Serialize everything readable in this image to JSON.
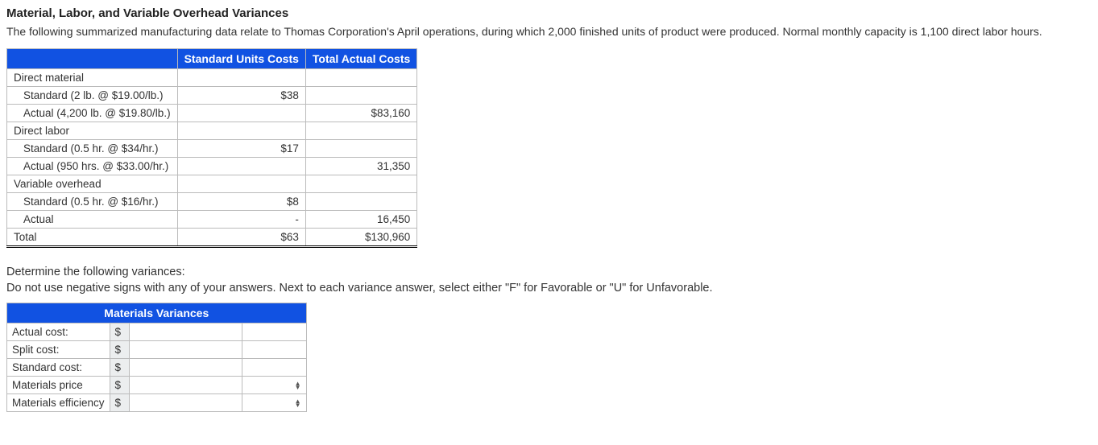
{
  "title": "Material, Labor, and Variable Overhead Variances",
  "intro": "The following summarized manufacturing data relate to Thomas Corporation's April operations, during which 2,000 finished units of product were produced. Normal monthly capacity is 1,100 direct labor hours.",
  "table1": {
    "headers": {
      "col1": "Standard Units Costs",
      "col2": "Total Actual Costs"
    },
    "rows": {
      "dm_header": "Direct material",
      "dm_std_label": "Standard (2 lb. @ $19.00/lb.)",
      "dm_std_val": "$38",
      "dm_act_label": "Actual (4,200 lb. @ $19.80/lb.)",
      "dm_act_val": "$83,160",
      "dl_header": "Direct labor",
      "dl_std_label": "Standard (0.5 hr. @ $34/hr.)",
      "dl_std_val": "$17",
      "dl_act_label": "Actual (950 hrs. @ $33.00/hr.)",
      "dl_act_val": "31,350",
      "vo_header": "Variable overhead",
      "vo_std_label": "Standard (0.5 hr. @ $16/hr.)",
      "vo_std_val": "$8",
      "vo_act_label": "Actual",
      "vo_act_std": "-",
      "vo_act_val": "16,450",
      "total_label": "Total",
      "total_std": "$63",
      "total_act": "$130,960"
    }
  },
  "instruction": "Determine the following variances:",
  "subinstruction": "Do not use negative signs with any of your answers. Next to each variance answer, select either \"F\" for Favorable or \"U\" for Unfavorable.",
  "table2": {
    "header": "Materials Variances",
    "dollar": "$",
    "rows": {
      "r1": "Actual cost:",
      "r2": "Split cost:",
      "r3": "Standard cost:",
      "r4": "Materials price",
      "r5": "Materials efficiency"
    }
  }
}
